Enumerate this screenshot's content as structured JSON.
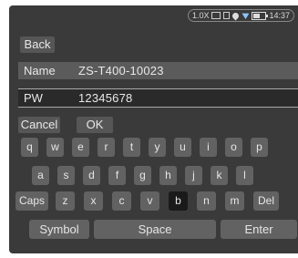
{
  "status": {
    "zoom": "1.0X",
    "time": "14:37",
    "icons": [
      "memory-card-icon",
      "sd-card-icon",
      "gps-icon",
      "wifi-icon",
      "battery-icon"
    ]
  },
  "buttons": {
    "back": "Back",
    "cancel": "Cancel",
    "ok": "OK"
  },
  "form": {
    "name": {
      "label": "Name",
      "value": "ZS-T400-10023"
    },
    "password": {
      "label": "PW",
      "value": "12345678"
    }
  },
  "keyboard": {
    "row1": [
      "q",
      "w",
      "e",
      "r",
      "t",
      "y",
      "u",
      "i",
      "o",
      "p"
    ],
    "row2": [
      "a",
      "s",
      "d",
      "f",
      "g",
      "h",
      "j",
      "k",
      "l"
    ],
    "row3": [
      "Caps",
      "z",
      "x",
      "c",
      "v",
      "b",
      "n",
      "m",
      "Del"
    ],
    "row4": [
      "Symbol",
      "Space",
      "Enter"
    ],
    "pressed_key": "b"
  },
  "colors": {
    "background": "#3a3a3a",
    "key": "#626262",
    "pressed_key": "#1a1a1a",
    "active_field": "#2a2a2a"
  }
}
